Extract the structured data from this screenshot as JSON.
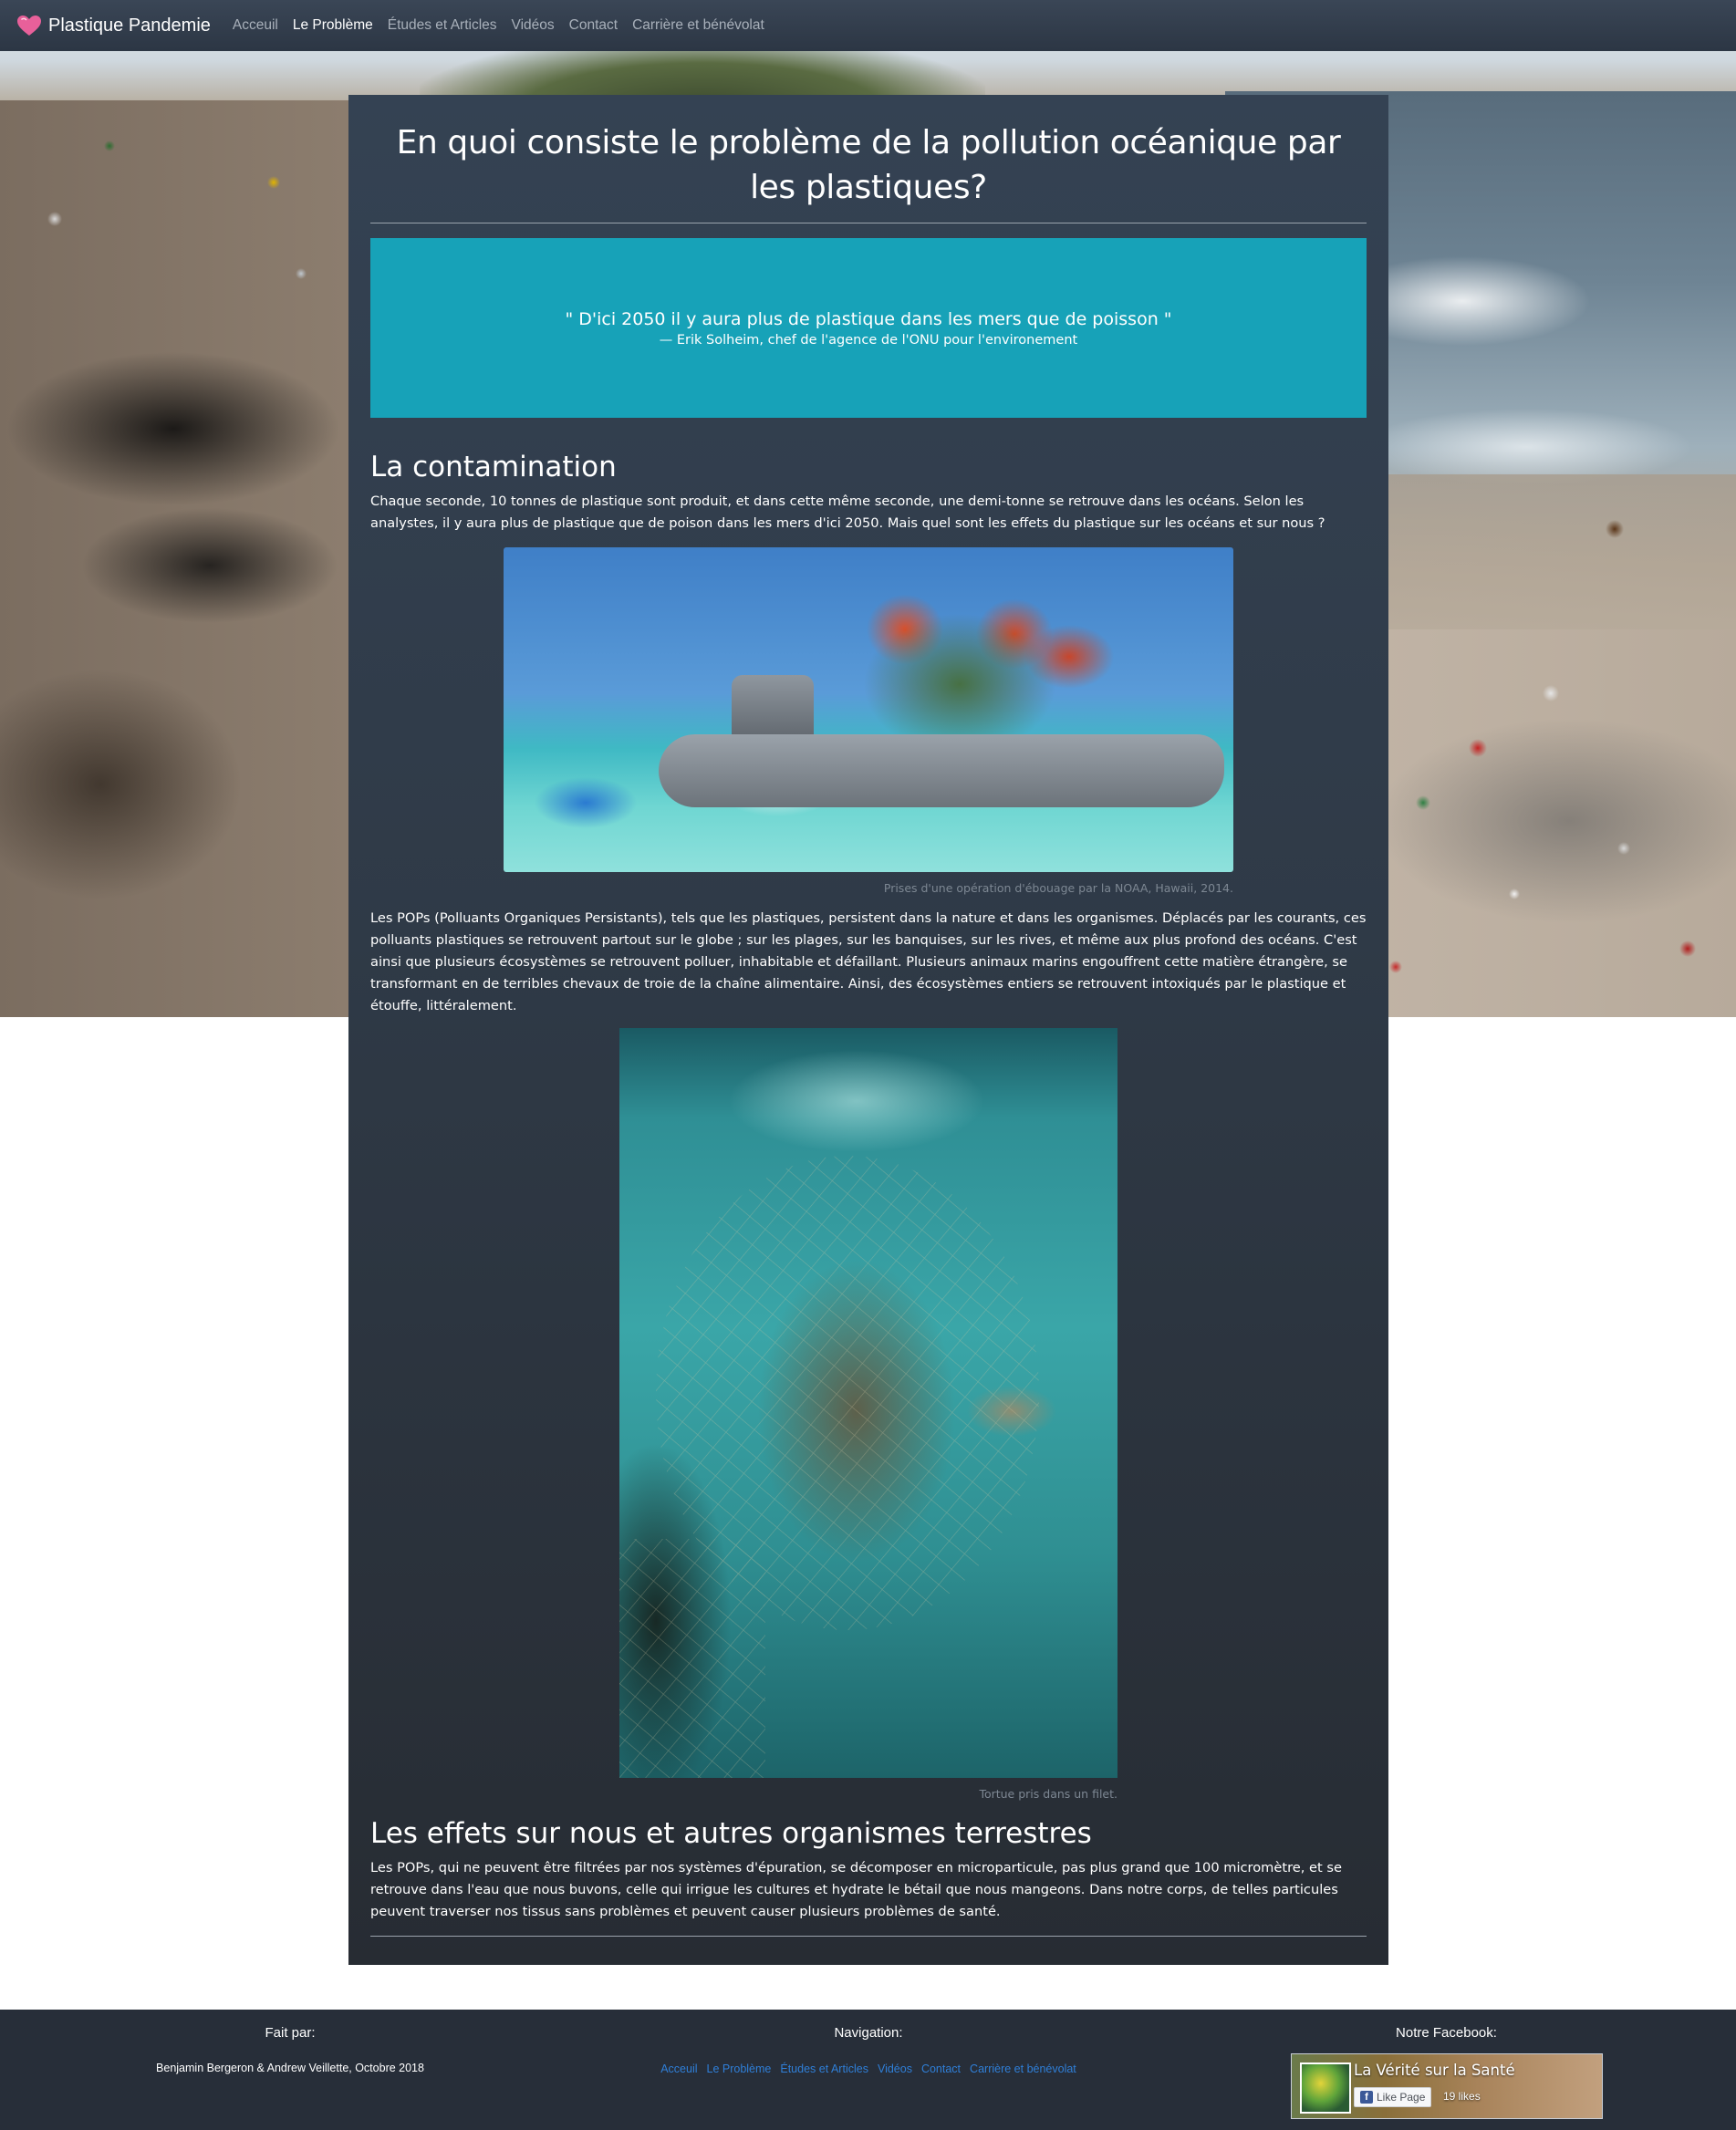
{
  "navbar": {
    "brand": "Plastique Pandemie",
    "brand_icon": "heart-icon",
    "brand_icon_color": "#e8609a",
    "links": [
      {
        "label": "Acceuil",
        "active": false
      },
      {
        "label": "Le Problème",
        "active": true
      },
      {
        "label": "Études et Articles",
        "active": false
      },
      {
        "label": "Vidéos",
        "active": false
      },
      {
        "label": "Contact",
        "active": false
      },
      {
        "label": "Carrière et bénévolat",
        "active": false
      }
    ]
  },
  "main": {
    "title": "En quoi consiste le problème de la pollution océanique par les plastiques?",
    "quote": {
      "text": "\" D'ici 2050 il y aura plus de plastique dans les mers que de poisson \"",
      "author": "— Erik Solheim, chef de l'agence de l'ONU pour l'environement",
      "background": "#17a2b8"
    },
    "section1": {
      "heading": "La contamination",
      "para1": "Chaque seconde, 10 tonnes de plastique sont produit, et dans cette même seconde, une demi-tonne se retrouve dans les océans. Selon les analystes, il y aura plus de plastique que de poison dans les mers d'ici 2050. Mais quel sont les effets du plastique sur les océans et sur nous ?",
      "image1_caption": "Prises d'une opération d'ébouage par la NOAA, Hawaii, 2014.",
      "para2": "Les POPs (Polluants Organiques Persistants), tels que les plastiques, persistent dans la nature et dans les organismes. Déplacés par les courants, ces polluants plastiques se retrouvent partout sur le globe ; sur les plages, sur les banquises, sur les rives, et même aux plus profond des océans. C'est ainsi que plusieurs écosystèmes se retrouvent polluer, inhabitable et défaillant. Plusieurs animaux marins engouffrent cette matière étrangère, se transformant en de terribles chevaux de troie de la chaîne alimentaire. Ainsi, des écosystèmes entiers se retrouvent intoxiqués par le plastique et étouffe, littéralement.",
      "image2_caption": "Tortue pris dans un filet."
    },
    "section2": {
      "heading": "Les effets sur nous et autres organismes terrestres",
      "para": "Les POPs, qui ne peuvent être filtrées par nos systèmes d'épuration, se décomposer en microparticule, pas plus grand que 100 micromètre, et se retrouve dans l'eau que nous buvons, celle qui irrigue les cultures et hydrate le bétail que nous mangeons. Dans notre corps, de telles particules peuvent traverser nos tissus sans problèmes et peuvent causer plusieurs problèmes de santé."
    }
  },
  "footer": {
    "made_by_heading": "Fait par:",
    "credits": "Benjamin Bergeron & Andrew Veillette, Octobre 2018",
    "nav_heading": "Navigation:",
    "nav_links": [
      "Acceuil",
      "Le Problème",
      "Études et Articles",
      "Vidéos",
      "Contact",
      "Carrière et bénévolat"
    ],
    "link_color": "#2f7fd8",
    "facebook_heading": "Notre Facebook:",
    "facebook": {
      "page_name": "La Vérité sur la Santé",
      "like_button": "Like Page",
      "likes": "19 likes"
    }
  }
}
